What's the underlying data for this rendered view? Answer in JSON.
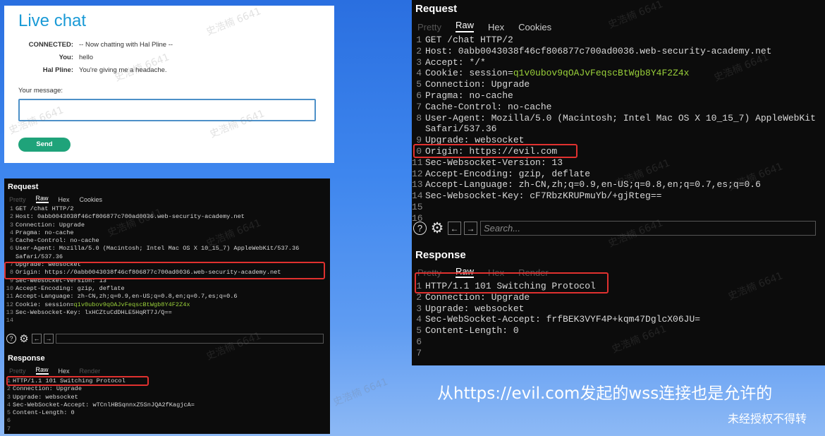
{
  "chat": {
    "title": "Live chat",
    "messages": [
      {
        "label": "CONNECTED:",
        "text": "-- Now chatting with Hal Pline --"
      },
      {
        "label": "You:",
        "text": "hello"
      },
      {
        "label": "Hal Pline:",
        "text": "You're giving me a headache."
      }
    ],
    "message_label": "Your message:",
    "send_label": "Send"
  },
  "small_panel": {
    "request_title": "Request",
    "request_tabs": [
      "Pretty",
      "Raw",
      "Hex",
      "Cookies"
    ],
    "request_lines": [
      {
        "n": "1",
        "t": "GET /chat HTTP/2"
      },
      {
        "n": "2",
        "t": "Host: 0abb0043038f46cf806877c700ad0036.web-security-academy.net"
      },
      {
        "n": "3",
        "t": "Connection: Upgrade"
      },
      {
        "n": "4",
        "t": "Pragma: no-cache"
      },
      {
        "n": "5",
        "t": "Cache-Control: no-cache"
      },
      {
        "n": "6",
        "t": "User-Agent: Mozilla/5.0 (Macintosh; Intel Mac OS X 10_15_7) AppleWebKit/537.36"
      },
      {
        "n": "",
        "t": "Safari/537.36"
      },
      {
        "n": "7",
        "t": "Upgrade: websocket"
      },
      {
        "n": "8",
        "t": "Origin: https://0abb0043038f46cf806877c700ad0036.web-security-academy.net"
      },
      {
        "n": "9",
        "t": "Sec-Websocket-Version: 13"
      },
      {
        "n": "10",
        "t": "Accept-Encoding: gzip, deflate"
      },
      {
        "n": "11",
        "t": "Accept-Language: zh-CN,zh;q=0.9,en-US;q=0.8,en;q=0.7,es;q=0.6"
      },
      {
        "n": "12",
        "t": "Cookie: session=",
        "g": "q1v0ubov9qOAJvFeqscBtWgb8Y4F2Z4x"
      },
      {
        "n": "13",
        "t": "Sec-Websocket-Key: lxHCZtuCdDHLE5HqRT7J/Q=="
      },
      {
        "n": "14",
        "t": ""
      }
    ],
    "search_placeholder": "",
    "response_title": "Response",
    "response_tabs": [
      "Pretty",
      "Raw",
      "Hex",
      "Render"
    ],
    "response_lines": [
      {
        "n": "1",
        "t": "HTTP/1.1 101 Switching Protocol"
      },
      {
        "n": "2",
        "t": "Connection: Upgrade"
      },
      {
        "n": "3",
        "t": "Upgrade: websocket"
      },
      {
        "n": "4",
        "t": "Sec-WebSocket-Accept: wTCnlHBSqnnxZ5SnJQA2fKagjcA="
      },
      {
        "n": "5",
        "t": "Content-Length: 0"
      },
      {
        "n": "6",
        "t": ""
      },
      {
        "n": "7",
        "t": ""
      }
    ]
  },
  "big_panel": {
    "request_title": "Request",
    "request_tabs": [
      "Pretty",
      "Raw",
      "Hex",
      "Cookies"
    ],
    "request_lines": [
      {
        "n": "1",
        "t": "GET /chat HTTP/2"
      },
      {
        "n": "2",
        "t": "Host: 0abb0043038f46cf806877c700ad0036.web-security-academy.net"
      },
      {
        "n": "3",
        "t": "Accept: */*"
      },
      {
        "n": "4",
        "t": "Cookie: session=",
        "g": "q1v0ubov9qOAJvFeqscBtWgb8Y4F2Z4x"
      },
      {
        "n": "5",
        "t": "Connection: Upgrade"
      },
      {
        "n": "6",
        "t": "Pragma: no-cache"
      },
      {
        "n": "7",
        "t": "Cache-Control: no-cache"
      },
      {
        "n": "8",
        "t": "User-Agent: Mozilla/5.0 (Macintosh; Intel Mac OS X 10_15_7) AppleWebKit"
      },
      {
        "n": "",
        "t": "Safari/537.36"
      },
      {
        "n": "9",
        "t": "Upgrade: websocket"
      },
      {
        "n": "0",
        "t": "Origin: https://evil.com"
      },
      {
        "n": "11",
        "t": "Sec-Websocket-Version: 13"
      },
      {
        "n": "12",
        "t": "Accept-Encoding: gzip, deflate"
      },
      {
        "n": "13",
        "t": "Accept-Language: zh-CN,zh;q=0.9,en-US;q=0.8,en;q=0.7,es;q=0.6"
      },
      {
        "n": "14",
        "t": "Sec-Websocket-Key: cF7RbzKRUPmuYb/+gjRteg=="
      },
      {
        "n": "15",
        "t": ""
      },
      {
        "n": "16",
        "t": ""
      }
    ],
    "search_placeholder": "Search...",
    "response_title": "Response",
    "response_tabs": [
      "Pretty",
      "Raw",
      "Hex",
      "Render"
    ],
    "response_lines": [
      {
        "n": "1",
        "t": "HTTP/1.1 101 Switching Protocol"
      },
      {
        "n": "2",
        "t": "Connection: Upgrade"
      },
      {
        "n": "3",
        "t": "Upgrade: websocket"
      },
      {
        "n": "4",
        "t": "Sec-WebSocket-Accept: frfBEK3VYF4P+kqm47DglcX06JU="
      },
      {
        "n": "5",
        "t": "Content-Length: 0"
      },
      {
        "n": "6",
        "t": ""
      },
      {
        "n": "7",
        "t": ""
      }
    ]
  },
  "caption": "从https://evil.com发起的wss连接也是允许的",
  "note": "未经授权不得转",
  "watermark": "史浩楠 6641",
  "colors": {
    "highlight_box": "#e0312f",
    "cookie_value": "#9ad13a",
    "chat_title": "#1a9ad6",
    "send_button": "#1fa37a"
  }
}
